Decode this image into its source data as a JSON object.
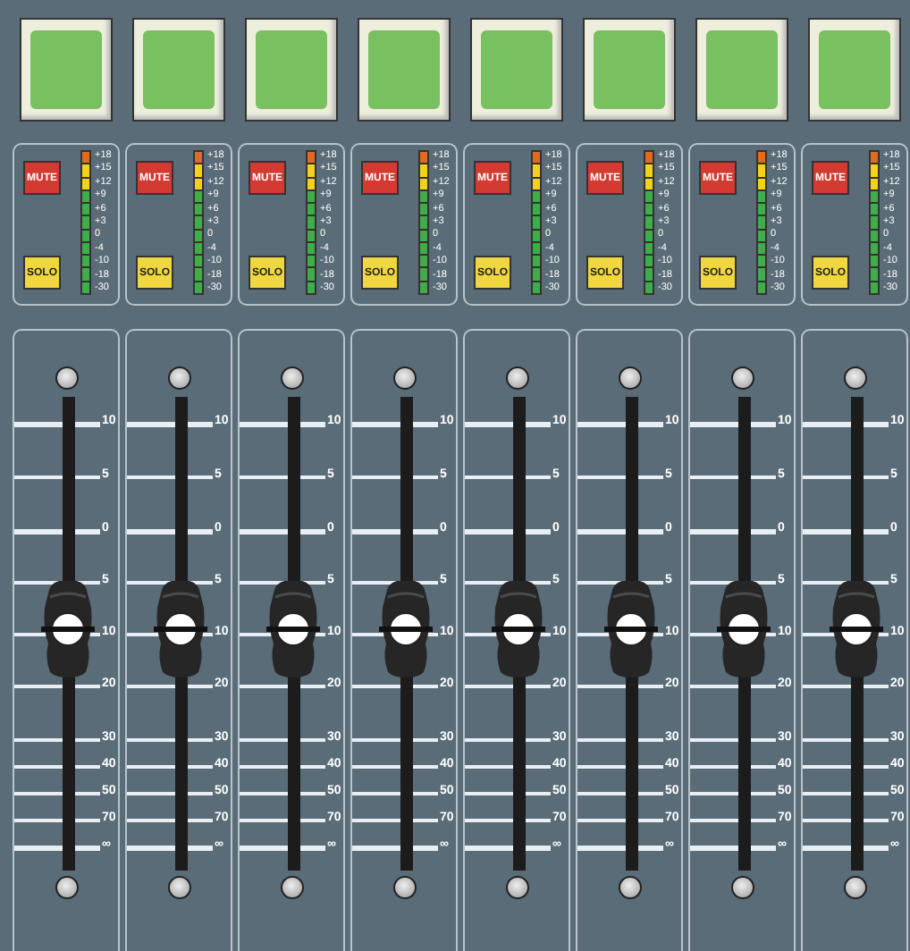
{
  "channels": [
    {
      "mute": "MUTE",
      "solo": "SOLO",
      "meter_labels": [
        "+18",
        "+15",
        "+12",
        "+9",
        "+6",
        "+3",
        "0",
        "-4",
        "-10",
        "-18",
        "-30"
      ],
      "scale": [
        "10",
        "5",
        "0",
        "5",
        "10",
        "20",
        "30",
        "40",
        "50",
        "70",
        "∞"
      ],
      "fader": {
        "level": 0.51
      }
    },
    {
      "mute": "MUTE",
      "solo": "SOLO",
      "meter_labels": [
        "+18",
        "+15",
        "+12",
        "+9",
        "+6",
        "+3",
        "0",
        "-4",
        "-10",
        "-18",
        "-30"
      ],
      "scale": [
        "10",
        "5",
        "0",
        "5",
        "10",
        "20",
        "30",
        "40",
        "50",
        "70",
        "∞"
      ],
      "fader": {
        "level": 0.51
      }
    },
    {
      "mute": "MUTE",
      "solo": "SOLO",
      "meter_labels": [
        "+18",
        "+15",
        "+12",
        "+9",
        "+6",
        "+3",
        "0",
        "-4",
        "-10",
        "-18",
        "-30"
      ],
      "scale": [
        "10",
        "5",
        "0",
        "5",
        "10",
        "20",
        "30",
        "40",
        "50",
        "70",
        "∞"
      ],
      "fader": {
        "level": 0.51
      }
    },
    {
      "mute": "MUTE",
      "solo": "SOLO",
      "meter_labels": [
        "+18",
        "+15",
        "+12",
        "+9",
        "+6",
        "+3",
        "0",
        "-4",
        "-10",
        "-18",
        "-30"
      ],
      "scale": [
        "10",
        "5",
        "0",
        "5",
        "10",
        "20",
        "30",
        "40",
        "50",
        "70",
        "∞"
      ],
      "fader": {
        "level": 0.51
      }
    },
    {
      "mute": "MUTE",
      "solo": "SOLO",
      "meter_labels": [
        "+18",
        "+15",
        "+12",
        "+9",
        "+6",
        "+3",
        "0",
        "-4",
        "-10",
        "-18",
        "-30"
      ],
      "scale": [
        "10",
        "5",
        "0",
        "5",
        "10",
        "20",
        "30",
        "40",
        "50",
        "70",
        "∞"
      ],
      "fader": {
        "level": 0.51
      }
    },
    {
      "mute": "MUTE",
      "solo": "SOLO",
      "meter_labels": [
        "+18",
        "+15",
        "+12",
        "+9",
        "+6",
        "+3",
        "0",
        "-4",
        "-10",
        "-18",
        "-30"
      ],
      "scale": [
        "10",
        "5",
        "0",
        "5",
        "10",
        "20",
        "30",
        "40",
        "50",
        "70",
        "∞"
      ],
      "fader": {
        "level": 0.51
      }
    },
    {
      "mute": "MUTE",
      "solo": "SOLO",
      "meter_labels": [
        "+18",
        "+15",
        "+12",
        "+9",
        "+6",
        "+3",
        "0",
        "-4",
        "-10",
        "-18",
        "-30"
      ],
      "scale": [
        "10",
        "5",
        "0",
        "5",
        "10",
        "20",
        "30",
        "40",
        "50",
        "70",
        "∞"
      ],
      "fader": {
        "level": 0.51
      }
    },
    {
      "mute": "MUTE",
      "solo": "SOLO",
      "meter_labels": [
        "+18",
        "+15",
        "+12",
        "+9",
        "+6",
        "+3",
        "0",
        "-4",
        "-10",
        "-18",
        "-30"
      ],
      "scale": [
        "10",
        "5",
        "0",
        "5",
        "10",
        "20",
        "30",
        "40",
        "50",
        "70",
        "∞"
      ],
      "fader": {
        "level": 0.51
      }
    }
  ]
}
